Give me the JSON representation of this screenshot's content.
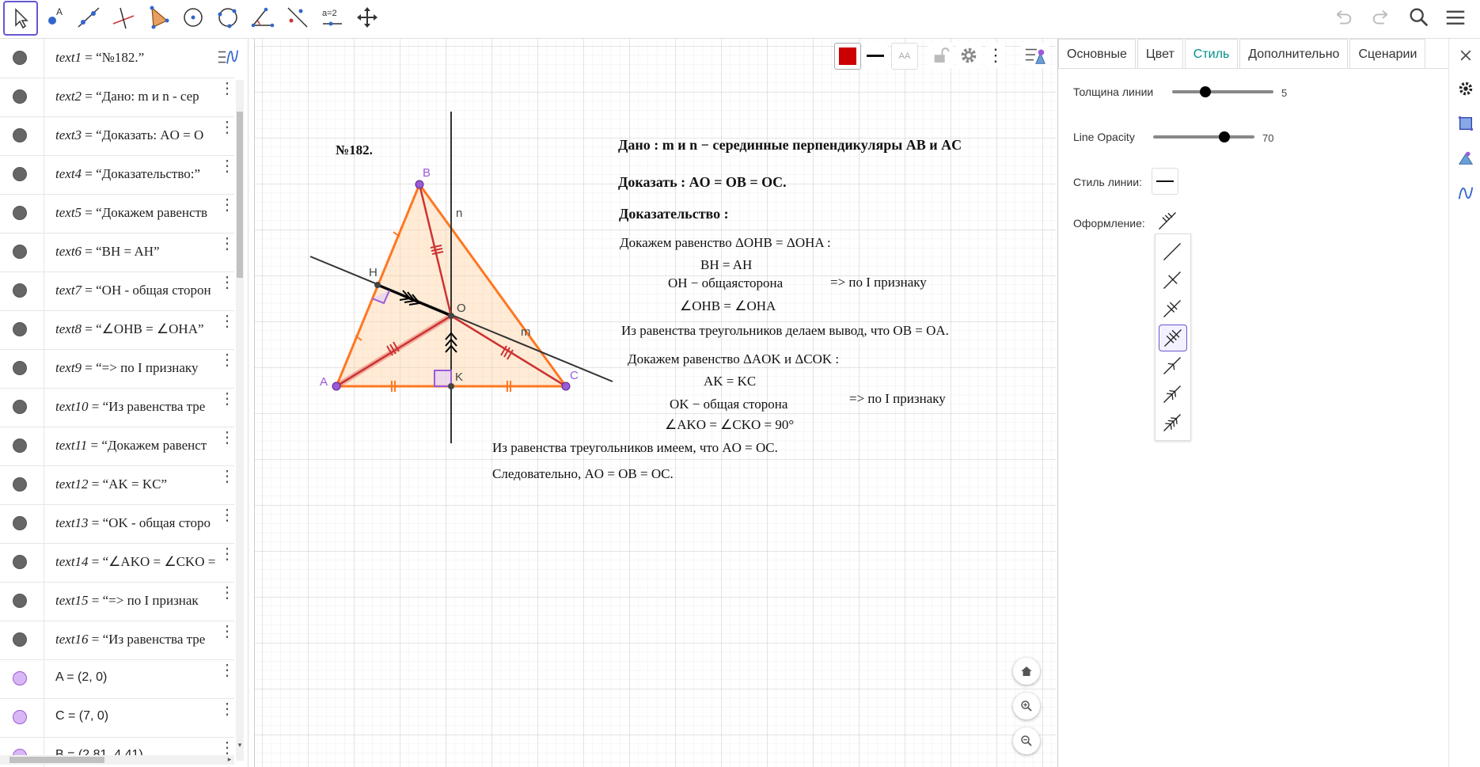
{
  "algebra": {
    "rows": [
      {
        "name": "text1",
        "value": "“№182.”",
        "type": "text"
      },
      {
        "name": "text2",
        "value": "“Дано:  m  и  n - сер",
        "type": "text"
      },
      {
        "name": "text3",
        "value": "“Доказать:  AO = O",
        "type": "text"
      },
      {
        "name": "text4",
        "value": "“Доказательство:”",
        "type": "text"
      },
      {
        "name": "text5",
        "value": "“Докажем  равенств",
        "type": "text"
      },
      {
        "name": "text6",
        "value": "“BH = AH”",
        "type": "text"
      },
      {
        "name": "text7",
        "value": "“OH - общая сторон",
        "type": "text"
      },
      {
        "name": "text8",
        "value": "“∠OHB = ∠OHA”",
        "type": "text"
      },
      {
        "name": "text9",
        "value": "“=>  по  I  признаку",
        "type": "text"
      },
      {
        "name": "text10",
        "value": "“Из  равенства  тре",
        "type": "text"
      },
      {
        "name": "text11",
        "value": "“Докажем  равенст",
        "type": "text"
      },
      {
        "name": "text12",
        "value": "“AK = KC”",
        "type": "text"
      },
      {
        "name": "text13",
        "value": "“OK - общая  сторо",
        "type": "text"
      },
      {
        "name": "text14",
        "value": "“∠AKO = ∠CKO =",
        "type": "text"
      },
      {
        "name": "text15",
        "value": "“=>  по  I  признак",
        "type": "text"
      },
      {
        "name": "text16",
        "value": "“Из  равенства  тре",
        "type": "text"
      },
      {
        "name": "",
        "value": "A = (2, 0)",
        "type": "point"
      },
      {
        "name": "",
        "value": "C = (7, 0)",
        "type": "point"
      },
      {
        "name": "",
        "value": "B = (2.81, 4.41)",
        "type": "point"
      }
    ]
  },
  "graphics": {
    "title": "№182.",
    "given": "Дано :  m и n − серединные перпендикуляры AB и AC",
    "prove": "Доказать :   AO = OB = OC.",
    "proof_heading": "Доказательство :",
    "proof1": "Докажем равенство  ΔOHB =  ΔOHA :",
    "proof2": "BH = AH",
    "proof3": "OH − общаясторона",
    "proof4": "=>  по I признаку",
    "proof5": "∠OHB =  ∠OHA",
    "proof6": "Из равенства треугольников делаем вывод,  что OB = OA.",
    "proof7": "Докажем равенство  ΔAOK и  ΔCOK :",
    "proof8": "AK = KC",
    "proof9": "OK − общая сторона",
    "proof10": "=>  по I признаку",
    "proof11": "∠AKO =  ∠CKO = 90°",
    "proof12": "Из равенства треугольников имеем,  что AO = OC.",
    "proof13": "Следовательно,  AO = OB = OC.",
    "point_labels": {
      "A": "A",
      "B": "B",
      "C": "C",
      "H": "H",
      "O": "O",
      "K": "K",
      "n": "n",
      "m": "m"
    },
    "style_bar_font_label": "AA"
  },
  "toolbar": {
    "slider_tool_label": "a=2"
  },
  "props": {
    "tabs": [
      "Основные",
      "Цвет",
      "Стиль",
      "Дополнительно",
      "Сценарии"
    ],
    "line_thickness_label": "Толщина линии",
    "line_thickness_value": "5",
    "line_thickness_level": 0.33,
    "line_opacity_label": "Line Opacity",
    "line_opacity_value": "70",
    "line_opacity_level": 0.7,
    "line_style_label": "Стиль линии:",
    "decoration_label": "Оформление:"
  },
  "colors": {
    "accent": "#6557d2",
    "selected_object": "#cc0000",
    "triangle_edge": "#ff7722",
    "triangle_fill": "#ffcc99",
    "point": "#9b5bd8",
    "active_tab": "#00918a"
  }
}
